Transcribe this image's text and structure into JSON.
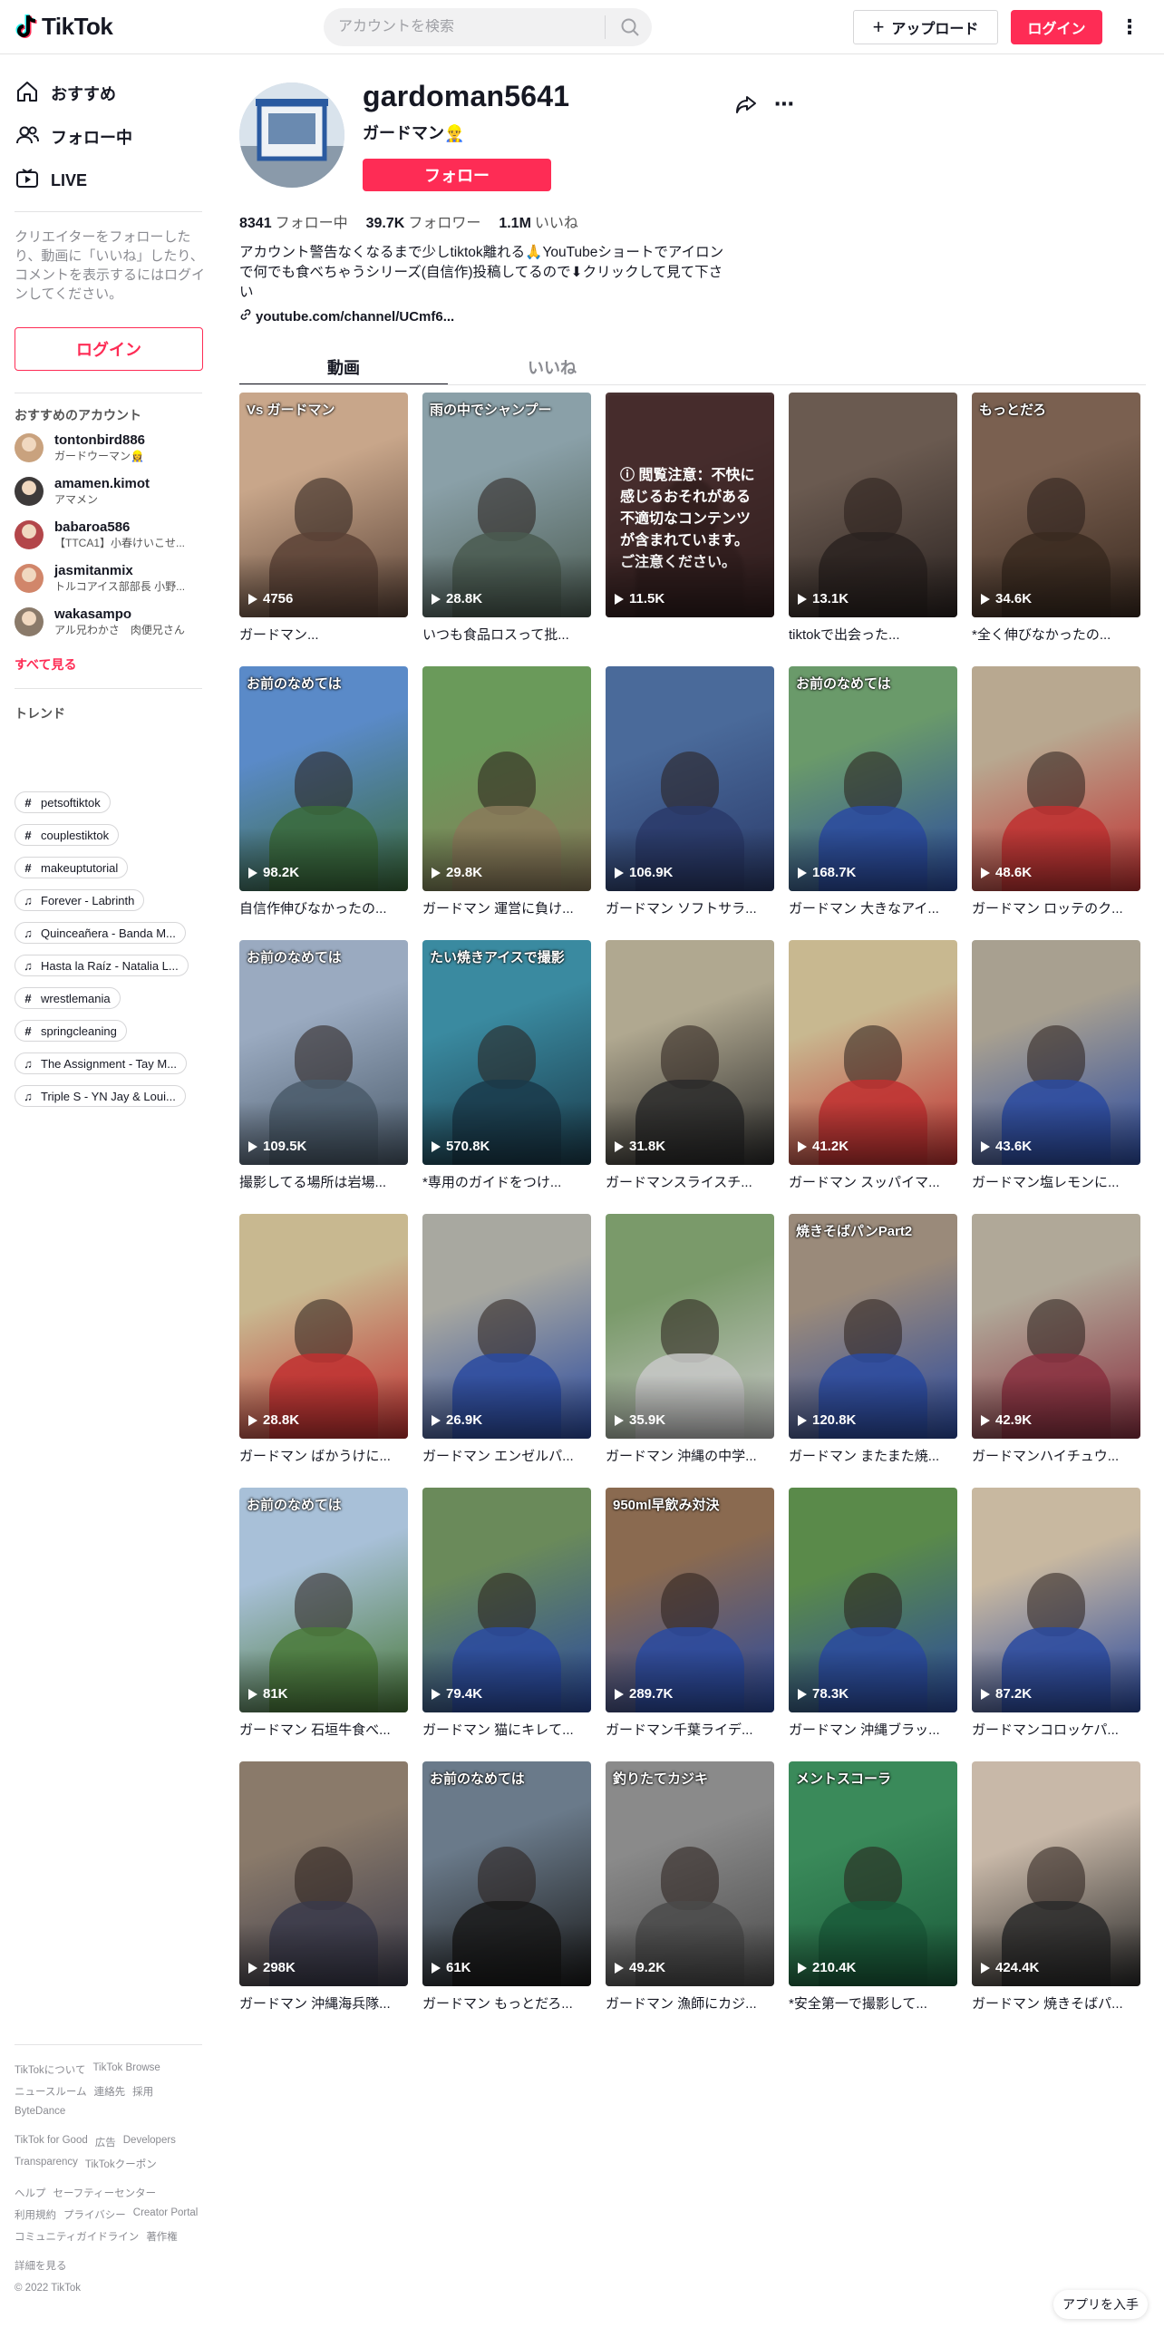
{
  "header": {
    "logo_text": "TikTok",
    "search_placeholder": "アカウントを検索",
    "upload_label": "アップロード",
    "login_label": "ログイン"
  },
  "sidebar": {
    "nav": [
      {
        "label": "おすすめ",
        "icon": "home-icon"
      },
      {
        "label": "フォロー中",
        "icon": "users-icon"
      },
      {
        "label": "LIVE",
        "icon": "live-icon"
      }
    ],
    "note": "クリエイターをフォローしたり、動画に「いいね」したり、コメントを表示するにはログインしてください。",
    "login_label": "ログイン",
    "suggested_heading": "おすすめのアカウント",
    "accounts": [
      {
        "name": "tontonbird886",
        "sub": "ガードウーマン👷‍♀️",
        "color": "#c9a27e"
      },
      {
        "name": "amamen.kimot",
        "sub": "アマメン",
        "color": "#3d3a3a"
      },
      {
        "name": "babaroa586",
        "sub": "【TTCA1】小春けいこせ...",
        "color": "#b3464a"
      },
      {
        "name": "jasmitanmix",
        "sub": "トルコアイス部部長 小野...",
        "color": "#d1866a"
      },
      {
        "name": "wakasampo",
        "sub": "アル兄わかさ　肉便兄さん",
        "color": "#8a7a6a"
      }
    ],
    "see_all": "すべて見る",
    "trend_heading": "トレンド",
    "trends": [
      {
        "type": "tag",
        "label": "petsoftiktok"
      },
      {
        "type": "tag",
        "label": "couplestiktok"
      },
      {
        "type": "tag",
        "label": "makeuptutorial"
      },
      {
        "type": "music",
        "label": "Forever - Labrinth"
      },
      {
        "type": "music",
        "label": "Quinceañera - Banda M..."
      },
      {
        "type": "music",
        "label": "Hasta la Raíz - Natalia L..."
      },
      {
        "type": "tag",
        "label": "wrestlemania"
      },
      {
        "type": "tag",
        "label": "springcleaning"
      },
      {
        "type": "music",
        "label": "The Assignment - Tay M..."
      },
      {
        "type": "music",
        "label": "Triple S - YN Jay & Loui..."
      }
    ],
    "footer": [
      [
        "TikTokについて",
        "TikTok Browse"
      ],
      [
        "ニュースルーム",
        "連絡先",
        "採用"
      ],
      [
        "ByteDance"
      ],
      [
        "TikTok for Good",
        "広告",
        "Developers"
      ],
      [
        "Transparency",
        "TikTokクーポン"
      ],
      [
        "ヘルプ",
        "セーフティーセンター"
      ],
      [
        "利用規約",
        "プライバシー",
        "Creator Portal"
      ],
      [
        "コミュニティガイドライン",
        "著作権"
      ],
      [
        "詳細を見る"
      ]
    ],
    "copyright": "© 2022 TikTok"
  },
  "profile": {
    "username": "gardoman5641",
    "nickname": "ガードマン👷‍♂️",
    "follow_label": "フォロー",
    "following_count": "8341",
    "following_label": "フォロー中",
    "followers_count": "39.7K",
    "followers_label": "フォロワー",
    "likes_count": "1.1M",
    "likes_label": "いいね",
    "bio": "アカウント警告なくなるまで少しtiktok離れる🙏YouTubeショートでアイロンで何でも食べちゃうシリーズ(自信作)投稿してるので⬇︎クリックして見て下さい",
    "link": "youtube.com/channel/UCmf6..."
  },
  "tabs": {
    "videos": "動画",
    "liked": "いいね"
  },
  "warning_text": "閲覧注意：不快に感じるおそれがある不適切なコンテンツが含まれています。ご注意ください。",
  "videos": [
    {
      "views": "4756",
      "caption": "ガードマン...",
      "overlay": "Vs ガードマン",
      "c1": "#c8a68a",
      "c2": "#5a4236"
    },
    {
      "views": "28.8K",
      "caption": "いつも食品ロスって批...",
      "overlay": "雨の中でシャンプー",
      "c1": "#8aa0a8",
      "c2": "#4a5a50"
    },
    {
      "views": "11.5K",
      "caption": "",
      "overlay": "",
      "warning": true,
      "c1": "#6a4a4a",
      "c2": "#3a2a2a"
    },
    {
      "views": "13.1K",
      "caption": "tiktokで出会った...",
      "overlay": "",
      "c1": "#6a5a50",
      "c2": "#2a2220"
    },
    {
      "views": "34.6K",
      "caption": "*全く伸びなかったの...",
      "overlay": "もっとだろ",
      "c1": "#7a6050",
      "c2": "#3a2a20"
    },
    {
      "views": "98.2K",
      "caption": "自信作伸びなかったの...",
      "overlay": "お前のなめては",
      "c1": "#5a8ac8",
      "c2": "#3a6a3a"
    },
    {
      "views": "29.8K",
      "caption": "ガードマン 運営に負け...",
      "overlay": "",
      "c1": "#6a9a5a",
      "c2": "#8a7a5a"
    },
    {
      "views": "106.9K",
      "caption": "ガードマン ソフトサラ...",
      "overlay": "",
      "c1": "#4a6a9a",
      "c2": "#2a3a6a"
    },
    {
      "views": "168.7K",
      "caption": "ガードマン 大きなアイ...",
      "overlay": "お前のなめては",
      "c1": "#6a9a6a",
      "c2": "#2a4aa0"
    },
    {
      "views": "48.6K",
      "caption": "ガードマン ロッテのク...",
      "overlay": "",
      "c1": "#b8a890",
      "c2": "#c03030"
    },
    {
      "views": "109.5K",
      "caption": "撮影してる場所は岩場...",
      "overlay": "お前のなめては",
      "c1": "#9aaac0",
      "c2": "#4a5a6a"
    },
    {
      "views": "570.8K",
      "caption": "*専用のガイドをつけ...",
      "overlay": "たい焼きアイスで撮影",
      "c1": "#3a8aa0",
      "c2": "#1a3a4a"
    },
    {
      "views": "31.8K",
      "caption": "ガードマンスライスチ...",
      "overlay": "",
      "c1": "#b0a890",
      "c2": "#2a2a2a"
    },
    {
      "views": "41.2K",
      "caption": "ガードマン スッパイマ...",
      "overlay": "",
      "c1": "#c8b890",
      "c2": "#c03030"
    },
    {
      "views": "43.6K",
      "caption": "ガードマン塩レモンに...",
      "overlay": "",
      "c1": "#a8a090",
      "c2": "#2a4aa0"
    },
    {
      "views": "28.8K",
      "caption": "ガードマン ばかうけに...",
      "overlay": "",
      "c1": "#c8b890",
      "c2": "#c03030"
    },
    {
      "views": "26.9K",
      "caption": "ガードマン エンゼルパ...",
      "overlay": "",
      "c1": "#a8a8a0",
      "c2": "#2a4aa0"
    },
    {
      "views": "35.9K",
      "caption": "ガードマン 沖縄の中学...",
      "overlay": "",
      "c1": "#7a9a6a",
      "c2": "#c8c8c8"
    },
    {
      "views": "120.8K",
      "caption": "ガードマン またまた焼...",
      "overlay": "焼きそばパンPart2",
      "c1": "#9a8a7a",
      "c2": "#2a4aa0"
    },
    {
      "views": "42.9K",
      "caption": "ガードマンハイチュウ...",
      "overlay": "",
      "c1": "#b0a898",
      "c2": "#8a3040"
    },
    {
      "views": "81K",
      "caption": "ガードマン 石垣牛食べ...",
      "overlay": "お前のなめては",
      "c1": "#a8c0d8",
      "c2": "#4a7a3a"
    },
    {
      "views": "79.4K",
      "caption": "ガードマン 猫にキレて...",
      "overlay": "",
      "c1": "#6a8a5a",
      "c2": "#2a4aa0"
    },
    {
      "views": "289.7K",
      "caption": "ガードマン千葉ライデ...",
      "overlay": "950ml早飲み対決",
      "c1": "#8a6a50",
      "c2": "#2a4aa0"
    },
    {
      "views": "78.3K",
      "caption": "ガードマン 沖縄ブラッ...",
      "overlay": "",
      "c1": "#5a8a4a",
      "c2": "#2a4aa0"
    },
    {
      "views": "87.2K",
      "caption": "ガードマンコロッケパ...",
      "overlay": "",
      "c1": "#c8b8a0",
      "c2": "#2a4aa0"
    },
    {
      "views": "298K",
      "caption": "ガードマン 沖縄海兵隊...",
      "overlay": "",
      "c1": "#8a7a6a",
      "c2": "#3a3a4a"
    },
    {
      "views": "61K",
      "caption": "ガードマン もっとだろ...",
      "overlay": "お前のなめては",
      "c1": "#6a7a8a",
      "c2": "#1a1a1a"
    },
    {
      "views": "49.2K",
      "caption": "ガードマン 漁師にカジ...",
      "overlay": "釣りたてカジキ",
      "c1": "#8a8a8a",
      "c2": "#4a4a4a"
    },
    {
      "views": "210.4K",
      "caption": "*安全第一で撮影して...",
      "overlay": "メントスコーラ",
      "c1": "#3a8a5a",
      "c2": "#1a5a3a"
    },
    {
      "views": "424.4K",
      "caption": "ガードマン 焼きそばパ...",
      "overlay": "",
      "c1": "#c8b8a8",
      "c2": "#2a2a2a"
    }
  ],
  "app_button": "アプリを入手"
}
